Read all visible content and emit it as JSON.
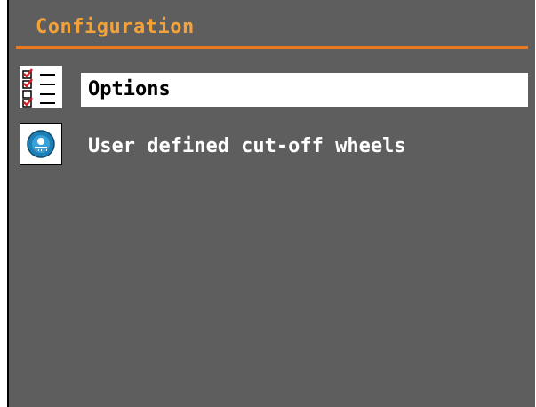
{
  "header": {
    "title": "Configuration"
  },
  "menu": {
    "items": [
      {
        "label": "Options",
        "icon": "checklist-icon",
        "selected": true
      },
      {
        "label": "User defined cut-off wheels",
        "icon": "cutoff-wheel-icon",
        "selected": false
      }
    ]
  },
  "colors": {
    "background": "#5e5e5e",
    "title": "#f3a23a",
    "rule": "#e87920",
    "selection": "#ffffff"
  }
}
